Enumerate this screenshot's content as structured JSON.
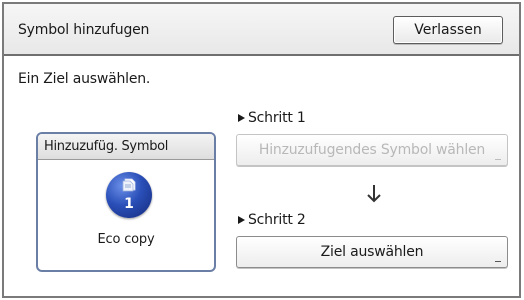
{
  "header": {
    "title": "Symbol hinzufugen",
    "exit_label": "Verlassen"
  },
  "instruction": "Ein Ziel auswählen.",
  "symbol_panel": {
    "header": "Hinzuzufüg. Symbol",
    "icon": "document-copy-icon",
    "icon_number": "1",
    "name": "Eco copy",
    "icon_color": "#2a4fb8"
  },
  "steps": [
    {
      "label": "Schritt 1",
      "button_label": "Hinzuzufugendes Symbol wählen",
      "enabled": false
    },
    {
      "label": "Schritt 2",
      "button_label": "Ziel auswählen",
      "enabled": true
    }
  ],
  "arrow_icon": "arrow-down-icon"
}
